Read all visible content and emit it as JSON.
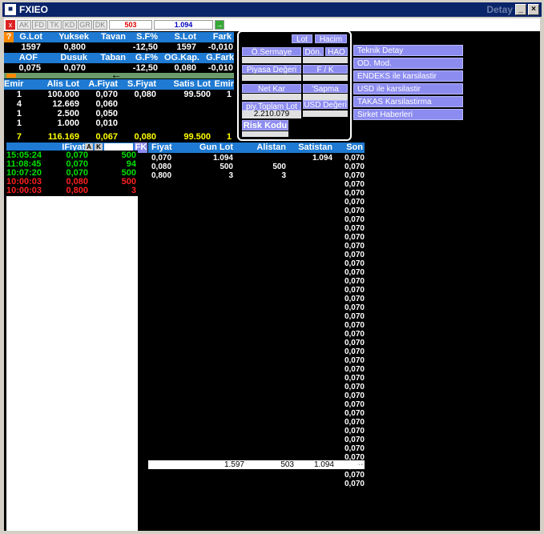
{
  "window": {
    "title": "FXIEO",
    "title_right": "Detay"
  },
  "toolbar": {
    "close": "x",
    "buttons": [
      "AK",
      "FD",
      "TK",
      "KD",
      "GR",
      "DK"
    ],
    "field1": "503",
    "field2": "1.094",
    "go": "→"
  },
  "hdr1": [
    "G.Lot",
    "Yuksek",
    "Tavan",
    "S.F%",
    "S.Lot",
    "Fark"
  ],
  "row1": [
    "1597",
    "0,800",
    "",
    "-12,50",
    "1597",
    "-0,010"
  ],
  "hdr2": [
    "AOF",
    "Dusuk",
    "Taban",
    "G.F%",
    "OG.Kap.",
    "G.Fark"
  ],
  "row2": [
    "0,075",
    "0,070",
    "",
    "-12,50",
    "0,080",
    "-0,010"
  ],
  "arrow": "←",
  "emir_hdr": [
    "Emir",
    "Alis Lot",
    "A.Fiyat",
    "S.Fiyat",
    "Satis Lot",
    "Emir"
  ],
  "emir_rows": [
    [
      "1",
      "100.000",
      "0,070",
      "0,080",
      "99.500",
      "1"
    ],
    [
      "4",
      "12.669",
      "0,060",
      "",
      "",
      ""
    ],
    [
      "1",
      "2.500",
      "0,050",
      "",
      "",
      ""
    ],
    [
      "1",
      "1.000",
      "0,010",
      "",
      "",
      ""
    ]
  ],
  "emir_total": [
    "7",
    "116.169",
    "0,067",
    "0,080",
    "99.500",
    "1"
  ],
  "popup": {
    "lot": "Lot",
    "hacim": "Hacim",
    "o_sermaye": "Ö.Sermaye",
    "don": "Dön.",
    "hao": "HAO",
    "piyasa": "Piyasa Değeri",
    "fk": "F / K",
    "net_kar": "Net Kar",
    "sapma": "'Sapma",
    "piy_toplam": "piy.Toplam Lot",
    "piy_toplam_val": "2.210.079",
    "usd": "USD Değeri",
    "risk": "Risk Kodu"
  },
  "menu": [
    "Teknik Detay",
    "OD. Mod.",
    "ENDEKS ile karsilastir",
    "USD ile karsilastir",
    "TAKAS Karsilastirma",
    "Sirket Haberleri"
  ],
  "trades_hdr": {
    "fiyat": "IFiyat",
    "a": "A",
    "k": "K",
    "fk": "FK"
  },
  "trades": [
    {
      "time": "15:05:24",
      "price": "0,070",
      "lot": "500",
      "color": "grn"
    },
    {
      "time": "11:08:45",
      "price": "0,070",
      "lot": "94",
      "color": "grn"
    },
    {
      "time": "10:07:20",
      "price": "0,070",
      "lot": "500",
      "color": "grn"
    },
    {
      "time": "10:00:03",
      "price": "0,080",
      "lot": "500",
      "color": "red"
    },
    {
      "time": "10:00:03",
      "price": "0,800",
      "lot": "3",
      "color": "red"
    }
  ],
  "book_hdr": [
    "Fiyat",
    "Gun Lot",
    "Alistan",
    "Satistan",
    "Son"
  ],
  "book_rows": [
    [
      "0,070",
      "1.094",
      "",
      "1.094",
      "0,070"
    ],
    [
      "0,080",
      "500",
      "500",
      "",
      "0,070"
    ],
    [
      "0,800",
      "3",
      "3",
      "",
      "0,070"
    ]
  ],
  "son_col": [
    "0,070",
    "0,070",
    "0,070",
    "0,070",
    "0,070",
    "0,070",
    "0,070",
    "0,070",
    "0,070",
    "0,070",
    "0,070",
    "0,070",
    "0,070",
    "0,070",
    "0,070",
    "0,070",
    "0,070",
    "0,070",
    "0,070",
    "0,070",
    "0,070",
    "0,070",
    "0,070",
    "0,070",
    "0,070",
    "0,070",
    "0,070",
    "0,070",
    "0,070",
    "0,070",
    "0,070",
    "0,070",
    "0,070",
    "0,070",
    "0,070"
  ],
  "totals": [
    "1.597",
    "503",
    "1.094",
    "--"
  ]
}
